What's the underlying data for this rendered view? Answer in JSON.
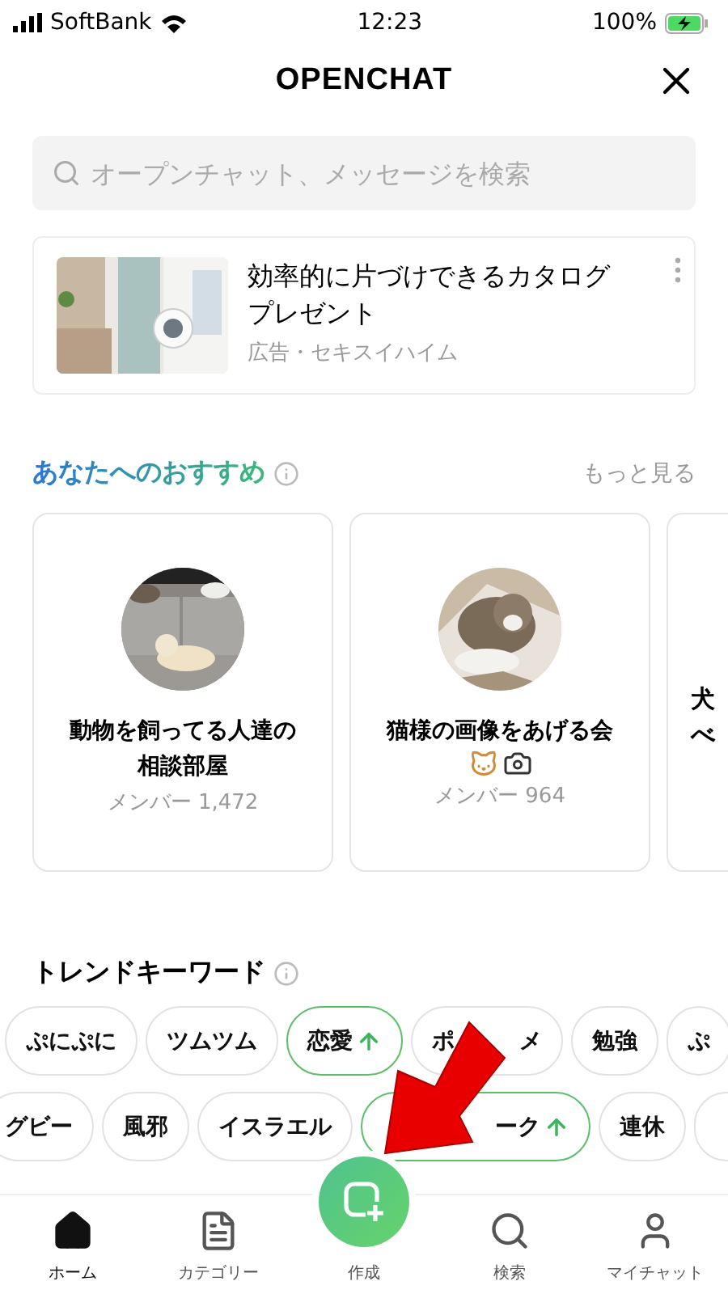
{
  "status_bar": {
    "carrier": "SoftBank",
    "time": "12:23",
    "battery": "100%"
  },
  "header": {
    "title": "OPENCHAT"
  },
  "search": {
    "placeholder": "オープンチャット、メッセージを検索"
  },
  "ad": {
    "title": "効率的に片づけできるカタログプレゼント",
    "sponsor": "広告・セキスイハイム"
  },
  "recommend": {
    "title": "あなたへのおすすめ",
    "more": "もっと見る",
    "cards": [
      {
        "kind": "full",
        "name": "動物を飼ってる人達の相談部屋",
        "members": "メンバー 1,472",
        "emoji_icons": false
      },
      {
        "kind": "full",
        "name": "猫様の画像をあげる会",
        "members": "メンバー 964",
        "emoji_icons": true
      },
      {
        "kind": "partial",
        "lines": [
          "犬",
          "べ"
        ]
      }
    ]
  },
  "trends": {
    "title": "トレンドキーワード",
    "rows": [
      [
        {
          "parts": [
            "ぷにぷに"
          ],
          "rising": false
        },
        {
          "parts": [
            "ツムツム"
          ],
          "rising": false
        },
        {
          "parts": [
            "恋愛"
          ],
          "rising": true
        },
        {
          "parts": [
            "ポ",
            "メ"
          ],
          "rising": false
        },
        {
          "parts": [
            "勉強"
          ],
          "rising": false
        },
        {
          "parts": [
            "ぷ"
          ],
          "rising": false
        }
      ],
      [
        {
          "parts": [
            "グビー"
          ],
          "rising": false
        },
        {
          "parts": [
            "風邪"
          ],
          "rising": false
        },
        {
          "parts": [
            "イスラエル"
          ],
          "rising": false
        },
        {
          "parts": [
            "ーク"
          ],
          "covered_start": true,
          "rising": true
        },
        {
          "parts": [
            "連休"
          ],
          "rising": false
        },
        {
          "rising": false
        }
      ]
    ]
  },
  "nav": [
    {
      "kind": "home",
      "label": "ホーム",
      "selected": true
    },
    {
      "kind": "category",
      "label": "カテゴリー",
      "selected": false
    },
    {
      "kind": "create",
      "label": "作成",
      "selected": false
    },
    {
      "kind": "search",
      "label": "検索",
      "selected": false
    },
    {
      "kind": "mychat",
      "label": "マイチャット",
      "selected": false
    }
  ]
}
